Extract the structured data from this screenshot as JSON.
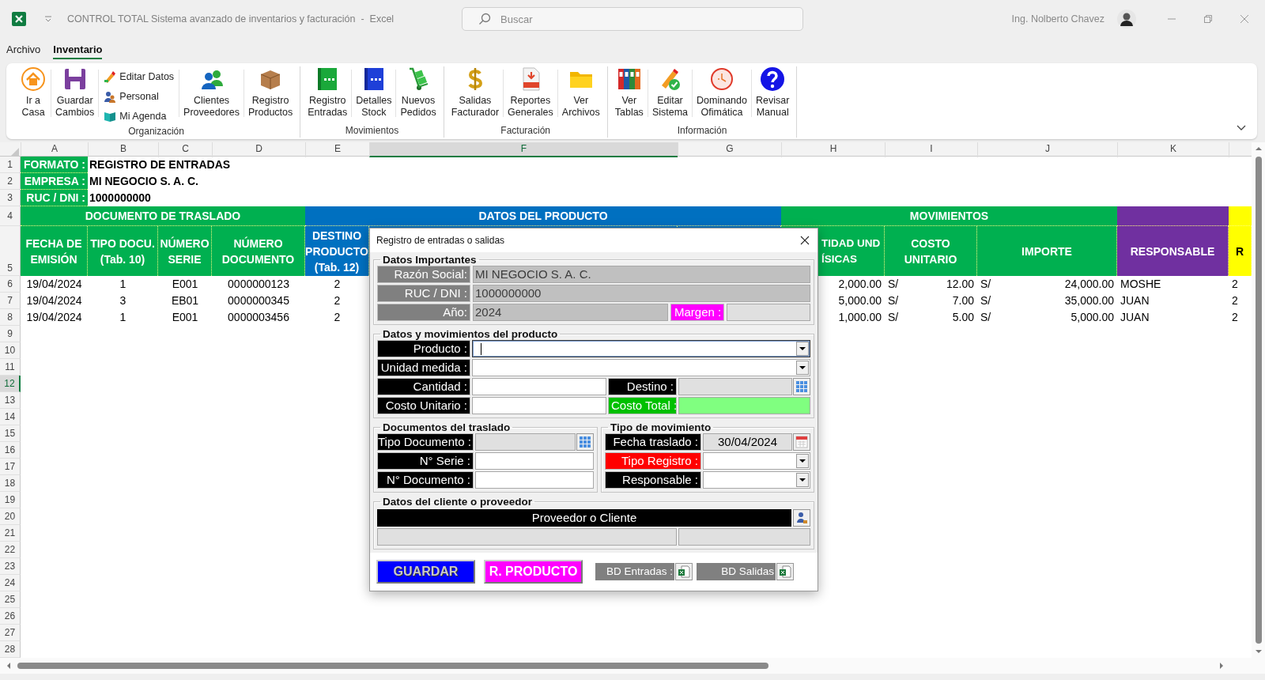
{
  "window": {
    "title": "CONTROL TOTAL Sistema avanzado de inventarios y facturación  -  Excel",
    "search": {
      "placeholder": "Buscar"
    },
    "user": "Ing. Nolberto Chavez"
  },
  "menu_tabs": [
    {
      "label": "Archivo",
      "selected": false
    },
    {
      "label": "Inventario",
      "selected": true
    }
  ],
  "ribbon": {
    "groups": [
      {
        "label": "Organización",
        "items": [
          {
            "kind": "large",
            "label": "Ir a\nCasa"
          },
          {
            "kind": "large",
            "label": "Guardar\nCambios"
          },
          {
            "kind": "stack",
            "entries": [
              "Editar Datos",
              "Personal",
              "Mi Agenda"
            ]
          },
          {
            "kind": "large",
            "label": "Clientes\nProveedores"
          },
          {
            "kind": "large",
            "label": "Registro\nProductos"
          }
        ]
      },
      {
        "label": "Movimientos",
        "items": [
          {
            "kind": "large",
            "label": "Registro\nEntradas"
          },
          {
            "kind": "large",
            "label": "Detalles\nStock"
          },
          {
            "kind": "large",
            "label": "Nuevos\nPedidos"
          }
        ]
      },
      {
        "label": "Facturación",
        "items": [
          {
            "kind": "large",
            "label": "Salidas\nFacturador"
          },
          {
            "kind": "large",
            "label": "Reportes\nGenerales"
          },
          {
            "kind": "large",
            "label": "Ver\nArchivos"
          }
        ]
      },
      {
        "label": "Información",
        "items": [
          {
            "kind": "large",
            "label": "Ver\nTablas"
          },
          {
            "kind": "large",
            "label": "Editar\nSistema"
          },
          {
            "kind": "large",
            "label": "Dominando\nOfimática"
          },
          {
            "kind": "large",
            "label": "Revisar\nManual"
          }
        ]
      }
    ]
  },
  "sheet": {
    "columns": [
      {
        "label": "A",
        "selected": false
      },
      {
        "label": "B",
        "selected": false
      },
      {
        "label": "C",
        "selected": false
      },
      {
        "label": "D",
        "selected": false
      },
      {
        "label": "E",
        "selected": false
      },
      {
        "label": "F",
        "selected": true
      },
      {
        "label": "G",
        "selected": false
      },
      {
        "label": "H",
        "selected": false
      },
      {
        "label": "I",
        "selected": false
      },
      {
        "label": "J",
        "selected": false
      },
      {
        "label": "K",
        "selected": false
      }
    ],
    "row_numbers": [
      {
        "label": "1",
        "selected": false
      },
      {
        "label": "2",
        "selected": false
      },
      {
        "label": "3",
        "selected": false
      },
      {
        "label": "4",
        "selected": false
      },
      {
        "label": "5",
        "selected": false
      },
      {
        "label": "6",
        "selected": false
      },
      {
        "label": "7",
        "selected": false
      },
      {
        "label": "8",
        "selected": false
      },
      {
        "label": "9",
        "selected": false
      },
      {
        "label": "10",
        "selected": false
      },
      {
        "label": "11",
        "selected": false
      },
      {
        "label": "12",
        "selected": true
      },
      {
        "label": "13",
        "selected": false
      },
      {
        "label": "14",
        "selected": false
      },
      {
        "label": "15",
        "selected": false
      },
      {
        "label": "16",
        "selected": false
      },
      {
        "label": "17",
        "selected": false
      },
      {
        "label": "18",
        "selected": false
      },
      {
        "label": "19",
        "selected": false
      },
      {
        "label": "20",
        "selected": false
      },
      {
        "label": "21",
        "selected": false
      },
      {
        "label": "22",
        "selected": false
      },
      {
        "label": "23",
        "selected": false
      },
      {
        "label": "24",
        "selected": false
      },
      {
        "label": "25",
        "selected": false
      },
      {
        "label": "26",
        "selected": false
      },
      {
        "label": "27",
        "selected": false
      },
      {
        "label": "28",
        "selected": false
      }
    ],
    "info": [
      {
        "label": "FORMATO :",
        "value": "REGISTRO DE ENTRADAS"
      },
      {
        "label": "EMPRESA :",
        "value": "MI NEGOCIO S. A. C."
      },
      {
        "label": "RUC / DNI :",
        "value": "1000000000"
      }
    ],
    "sections": [
      {
        "label": "DOCUMENTO DE TRASLADO",
        "color": "#00b050"
      },
      {
        "label": "DATOS DEL PRODUCTO",
        "color": "#0070c0"
      },
      {
        "label": "MOVIMIENTOS",
        "color": "#00b050"
      },
      {
        "color": "#7030a0"
      },
      {
        "color": "#ffff00"
      }
    ],
    "headers": [
      {
        "label": "FECHA DE\nEMISIÓN",
        "color": "#00b050"
      },
      {
        "label": "TIPO DOCU.\n(Tab. 10)",
        "color": "#00b050"
      },
      {
        "label": "NÚMERO\nSERIE",
        "color": "#00b050"
      },
      {
        "label": "NÚMERO\nDOCUMENTO",
        "color": "#00b050"
      },
      {
        "label": "DESTINO\nPRODUCTO\n(Tab. 12)",
        "color": "#0070c0"
      },
      {
        "label": "TIDAD UND\nÍSICAS",
        "color": "#00b050"
      },
      {
        "label": "COSTO\nUNITARIO",
        "color": "#00b050"
      },
      {
        "label": "IMPORTE",
        "color": "#00b050"
      },
      {
        "label": "RESPONSABLE",
        "color": "#7030a0"
      },
      {
        "label": "R",
        "color": "#ffff00"
      }
    ],
    "rows": [
      {
        "fecha": "19/04/2024",
        "tipo_docu": "1",
        "serie": "E001",
        "numero": "0000000123",
        "destino": "2",
        "cantidad": "2,000.00",
        "moneda_costo": "S/",
        "costo": "12.00",
        "moneda_importe": "S/",
        "importe": "24,000.00",
        "responsable": "MOSHE",
        "column_l": "2"
      },
      {
        "fecha": "19/04/2024",
        "tipo_docu": "3",
        "serie": "EB01",
        "numero": "0000000345",
        "destino": "2",
        "cantidad": "5,000.00",
        "moneda_costo": "S/",
        "costo": "7.00",
        "moneda_importe": "S/",
        "importe": "35,000.00",
        "responsable": "JUAN",
        "column_l": "2"
      },
      {
        "fecha": "19/04/2024",
        "tipo_docu": "1",
        "serie": "E001",
        "numero": "0000003456",
        "destino": "2",
        "cantidad": "1,000.00",
        "moneda_costo": "S/",
        "costo": "5.00",
        "moneda_importe": "S/",
        "importe": "5,000.00",
        "responsable": "JUAN",
        "column_l": "2"
      }
    ]
  },
  "dialog": {
    "title": "Registro de entradas o salidas",
    "important": {
      "title": "Datos Importantes",
      "fields": [
        {
          "label": "Razón Social:",
          "value": "MI NEGOCIO S. A. C."
        },
        {
          "label": "RUC / DNI :",
          "value": "1000000000"
        },
        {
          "label": "Año:",
          "value": "2024"
        }
      ],
      "margin_label": "Margen :"
    },
    "product": {
      "title": "Datos y movimientos del producto",
      "fields": [
        {
          "label": "Producto :",
          "kind": "combo",
          "focused": true
        },
        {
          "label": "Unidad medida :",
          "kind": "combo",
          "focused": false
        },
        {
          "label": "Cantidad :",
          "kind": "text"
        },
        {
          "label": "Destino :",
          "kind": "picker"
        },
        {
          "label": "Costo Unitario :",
          "kind": "text"
        },
        {
          "label": "Costo Total :",
          "kind": "total"
        }
      ]
    },
    "documents": {
      "title": "Documentos del traslado",
      "fields": [
        {
          "label": "Tipo Documento :",
          "kind": "picker"
        },
        {
          "label": "N° Serie :",
          "kind": "text"
        },
        {
          "label": "N° Documento :",
          "kind": "text"
        }
      ]
    },
    "movement": {
      "title": "Tipo de movimiento",
      "fields": [
        {
          "label": "Fecha traslado :",
          "kind": "date",
          "value": "30/04/2024",
          "color": "#000000"
        },
        {
          "label": "Tipo Registro :",
          "kind": "combo",
          "color": "#ff0000"
        },
        {
          "label": "Responsable :",
          "kind": "combo",
          "color": "#000000"
        }
      ]
    },
    "client": {
      "title": "Datos del cliente o proveedor",
      "header": "Proveedor o Cliente"
    },
    "buttons": [
      {
        "label": "GUARDAR",
        "kind": "save"
      },
      {
        "label": "R. PRODUCTO",
        "kind": "product"
      }
    ],
    "databases": [
      {
        "label": "BD Entradas :"
      },
      {
        "label": "BD Salidas"
      }
    ]
  }
}
